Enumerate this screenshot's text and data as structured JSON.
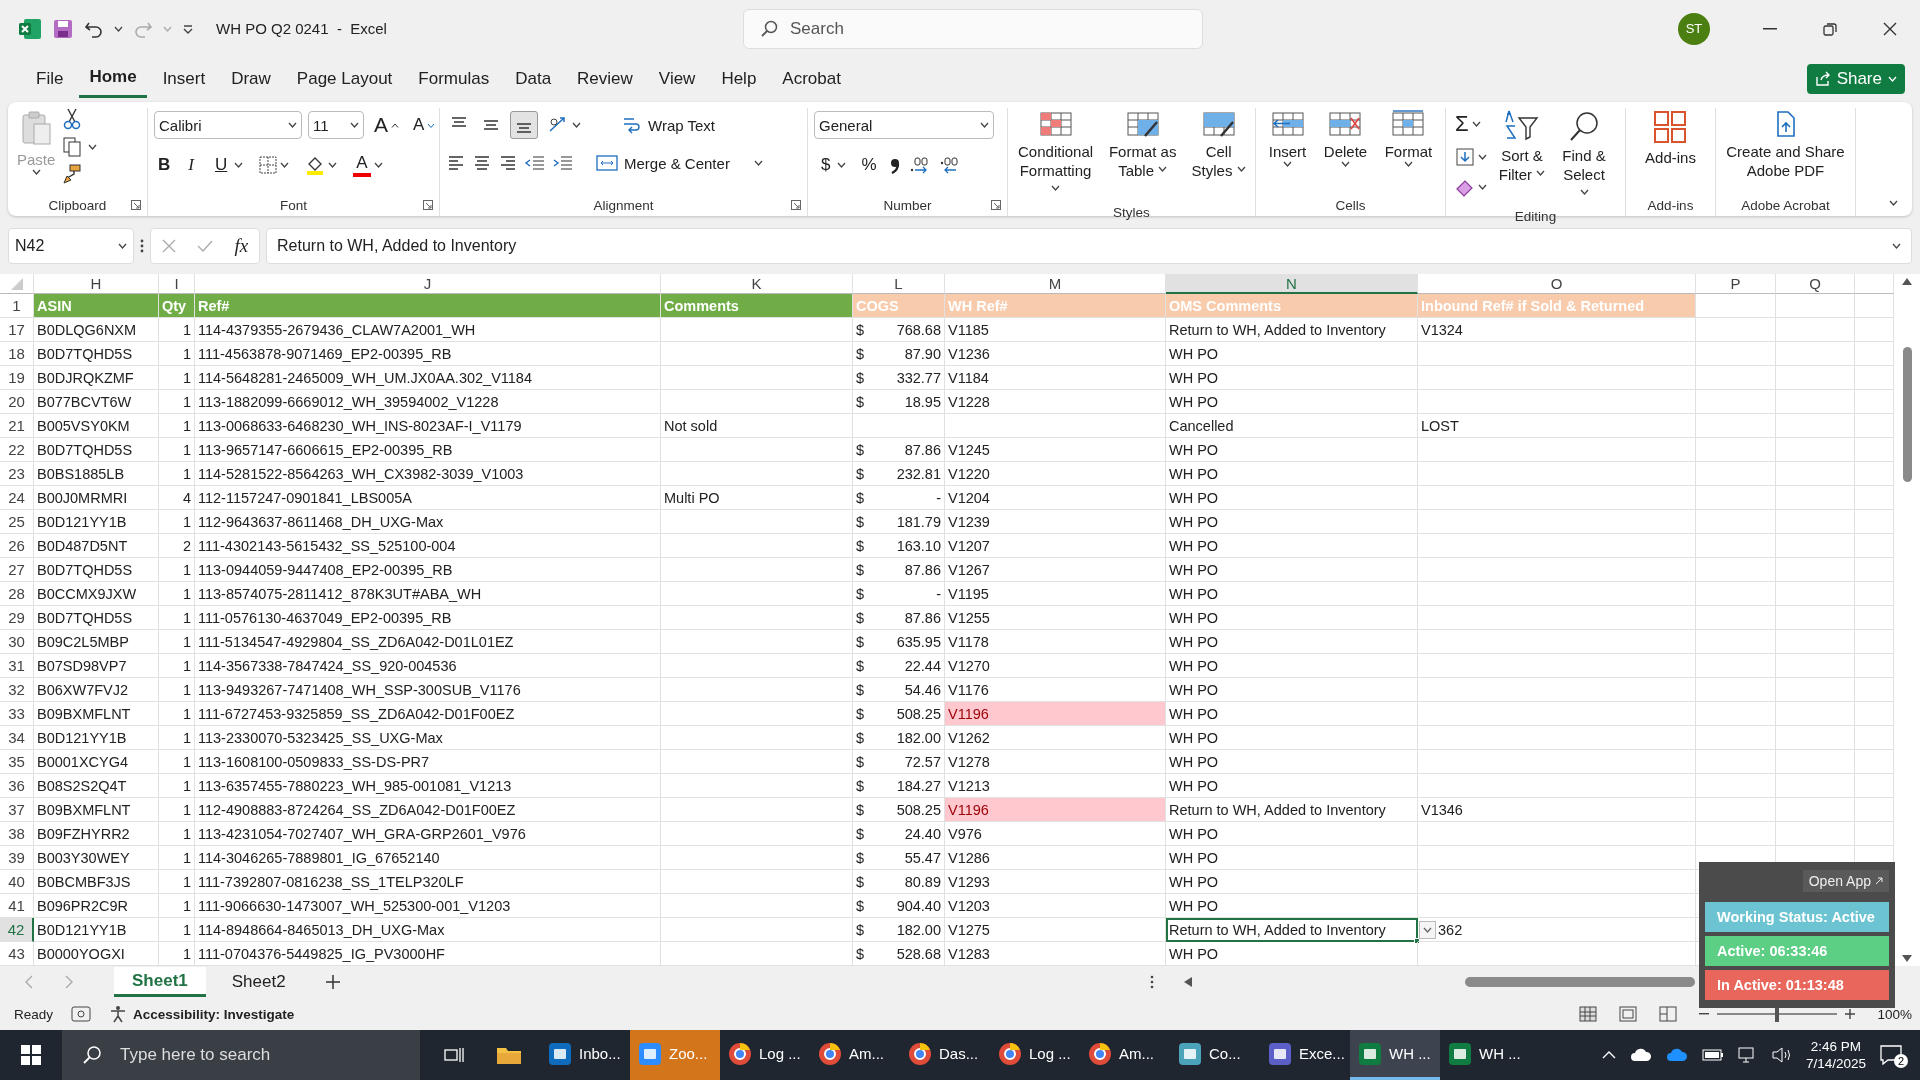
{
  "window": {
    "title": "WH PO Q2 0241  -  Excel",
    "search": {
      "placeholder": "Search"
    },
    "avatar": "ST"
  },
  "menu": [
    {
      "label": "File",
      "selected": false
    },
    {
      "label": "Home",
      "selected": true
    },
    {
      "label": "Insert",
      "selected": false
    },
    {
      "label": "Draw",
      "selected": false
    },
    {
      "label": "Page Layout",
      "selected": false
    },
    {
      "label": "Formulas",
      "selected": false
    },
    {
      "label": "Data",
      "selected": false
    },
    {
      "label": "Review",
      "selected": false
    },
    {
      "label": "View",
      "selected": false
    },
    {
      "label": "Help",
      "selected": false
    },
    {
      "label": "Acrobat",
      "selected": false
    }
  ],
  "share_button": "Share",
  "ribbon": {
    "clipboard": {
      "label": "Clipboard",
      "paste": "Paste",
      "paste_disabled": true
    },
    "font": {
      "label": "Font",
      "face": "Calibri",
      "size": "11",
      "grow": "A",
      "shrink": "A",
      "bold": "B",
      "italic": "I",
      "underline": "U",
      "font_color": "A"
    },
    "alignment": {
      "label": "Alignment",
      "vertical_align": [
        {
          "selected": false
        },
        {
          "selected": false
        },
        {
          "selected": true
        }
      ],
      "wrap": "Wrap Text",
      "merge": "Merge & Center"
    },
    "number": {
      "label": "Number",
      "format": "General",
      "currency": "$",
      "percent": "%"
    },
    "styles": {
      "label": "Styles",
      "buttons": [
        "Conditional Formatting",
        "Format as Table",
        "Cell Styles"
      ]
    },
    "cells": {
      "label": "Cells",
      "buttons": [
        "Insert",
        "Delete",
        "Format"
      ]
    },
    "editing": {
      "label": "Editing",
      "sum": "Σ",
      "buttons": [
        "Sort & Filter",
        "Find & Select"
      ]
    },
    "addins": {
      "label": "Add-ins",
      "buttons": [
        "Add-ins"
      ]
    },
    "acrobat": {
      "label": "Adobe Acrobat",
      "buttons": [
        "Create and Share Adobe PDF"
      ]
    }
  },
  "formula_bar": {
    "name_box": "N42",
    "function_label": "fx",
    "formula": "Return to WH, Added to Inventory"
  },
  "sheet": {
    "columns": [
      {
        "letter": "H",
        "selected": false
      },
      {
        "letter": "I",
        "selected": false
      },
      {
        "letter": "J",
        "selected": false
      },
      {
        "letter": "K",
        "selected": false
      },
      {
        "letter": "L",
        "selected": false
      },
      {
        "letter": "M",
        "selected": false
      },
      {
        "letter": "N",
        "selected": true
      },
      {
        "letter": "O",
        "selected": false
      },
      {
        "letter": "P",
        "selected": false
      },
      {
        "letter": "Q",
        "selected": false
      }
    ],
    "header_row": {
      "row": "1",
      "cells": [
        {
          "text": "ASIN",
          "color": "#70ad47"
        },
        {
          "text": "Qty",
          "color": "#70ad47"
        },
        {
          "text": "Ref#",
          "color": "#70ad47"
        },
        {
          "text": "Comments",
          "color": "#70ad47"
        },
        {
          "text": "COGS",
          "color": "#f8cbad"
        },
        {
          "text": "WH Ref#",
          "color": "#f8cbad"
        },
        {
          "text": "OMS Comments",
          "color": "#f8cbad"
        },
        {
          "text": "Inbound Ref# if Sold & Returned",
          "color": "#f8cbad"
        }
      ]
    },
    "rows": [
      {
        "row": "17",
        "asin": "B0DLQG6NXM",
        "qty": "1",
        "ref": "114-4379355-2679436_CLAW7A2001_WH",
        "cogs": {
          "symbol": "$",
          "amount": "768.68"
        },
        "wh_ref": "V1185",
        "wh_ref_flagged": false,
        "oms_comments": "Return to WH, Added to Inventory",
        "inbound_ref": "V1324",
        "selected": false
      },
      {
        "row": "18",
        "asin": "B0D7TQHD5S",
        "qty": "1",
        "ref": "111-4563878-9071469_EP2-00395_RB",
        "cogs": {
          "symbol": "$",
          "amount": "87.90"
        },
        "wh_ref": "V1236",
        "wh_ref_flagged": false,
        "oms_comments": "WH PO",
        "selected": false
      },
      {
        "row": "19",
        "asin": "B0DJRQKZMF",
        "qty": "1",
        "ref": "114-5648281-2465009_WH_UM.JX0AA.302_V1184",
        "cogs": {
          "symbol": "$",
          "amount": "332.77"
        },
        "wh_ref": "V1184",
        "wh_ref_flagged": false,
        "oms_comments": "WH PO",
        "selected": false
      },
      {
        "row": "20",
        "asin": "B077BCVT6W",
        "qty": "1",
        "ref": "113-1882099-6669012_WH_39594002_V1228",
        "cogs": {
          "symbol": "$",
          "amount": "18.95"
        },
        "wh_ref": "V1228",
        "wh_ref_flagged": false,
        "oms_comments": "WH PO",
        "selected": false
      },
      {
        "row": "21",
        "asin": "B005VSY0KM",
        "qty": "1",
        "ref": "113-0068633-6468230_WH_INS-8023AF-I_V1179",
        "comments": "Not sold",
        "wh_ref_flagged": false,
        "oms_comments": "Cancelled",
        "inbound_ref": "LOST",
        "selected": false
      },
      {
        "row": "22",
        "asin": "B0D7TQHD5S",
        "qty": "1",
        "ref": "113-9657147-6606615_EP2-00395_RB",
        "cogs": {
          "symbol": "$",
          "amount": "87.86"
        },
        "wh_ref": "V1245",
        "wh_ref_flagged": false,
        "oms_comments": "WH PO",
        "selected": false
      },
      {
        "row": "23",
        "asin": "B0BS1885LB",
        "qty": "1",
        "ref": "114-5281522-8564263_WH_CX3982-3039_V1003",
        "cogs": {
          "symbol": "$",
          "amount": "232.81"
        },
        "wh_ref": "V1220",
        "wh_ref_flagged": false,
        "oms_comments": "WH PO",
        "selected": false
      },
      {
        "row": "24",
        "asin": "B00J0MRMRI",
        "qty": "4",
        "ref": "112-1157247-0901841_LBS005A",
        "comments": "Multi PO",
        "cogs": {
          "symbol": "$",
          "amount": "-"
        },
        "wh_ref": "V1204",
        "wh_ref_flagged": false,
        "oms_comments": "WH PO",
        "selected": false
      },
      {
        "row": "25",
        "asin": "B0D121YY1B",
        "qty": "1",
        "ref": "112-9643637-8611468_DH_UXG-Max",
        "cogs": {
          "symbol": "$",
          "amount": "181.79"
        },
        "wh_ref": "V1239",
        "wh_ref_flagged": false,
        "oms_comments": "WH PO",
        "selected": false
      },
      {
        "row": "26",
        "asin": "B0D487D5NT",
        "qty": "2",
        "ref": "111-4302143-5615432_SS_525100-004",
        "cogs": {
          "symbol": "$",
          "amount": "163.10"
        },
        "wh_ref": "V1207",
        "wh_ref_flagged": false,
        "oms_comments": "WH PO",
        "selected": false
      },
      {
        "row": "27",
        "asin": "B0D7TQHD5S",
        "qty": "1",
        "ref": "113-0944059-9447408_EP2-00395_RB",
        "cogs": {
          "symbol": "$",
          "amount": "87.86"
        },
        "wh_ref": "V1267",
        "wh_ref_flagged": false,
        "oms_comments": "WH PO",
        "selected": false
      },
      {
        "row": "28",
        "asin": "B0CCMX9JXW",
        "qty": "1",
        "ref": "113-8574075-2811412_878K3UT#ABA_WH",
        "cogs": {
          "symbol": "$",
          "amount": "-"
        },
        "wh_ref": "V1195",
        "wh_ref_flagged": false,
        "oms_comments": "WH PO",
        "selected": false
      },
      {
        "row": "29",
        "asin": "B0D7TQHD5S",
        "qty": "1",
        "ref": "111-0576130-4637049_EP2-00395_RB",
        "cogs": {
          "symbol": "$",
          "amount": "87.86"
        },
        "wh_ref": "V1255",
        "wh_ref_flagged": false,
        "oms_comments": "WH PO",
        "selected": false
      },
      {
        "row": "30",
        "asin": "B09C2L5MBP",
        "qty": "1",
        "ref": "111-5134547-4929804_SS_ZD6A042-D01L01EZ",
        "cogs": {
          "symbol": "$",
          "amount": "635.95"
        },
        "wh_ref": "V1178",
        "wh_ref_flagged": false,
        "oms_comments": "WH PO",
        "selected": false
      },
      {
        "row": "31",
        "asin": "B07SD98VP7",
        "qty": "1",
        "ref": "114-3567338-7847424_SS_920-004536",
        "cogs": {
          "symbol": "$",
          "amount": "22.44"
        },
        "wh_ref": "V1270",
        "wh_ref_flagged": false,
        "oms_comments": "WH PO",
        "selected": false
      },
      {
        "row": "32",
        "asin": "B06XW7FVJ2",
        "qty": "1",
        "ref": "113-9493267-7471408_WH_SSP-300SUB_V1176",
        "cogs": {
          "symbol": "$",
          "amount": "54.46"
        },
        "wh_ref": "V1176",
        "wh_ref_flagged": false,
        "oms_comments": "WH PO",
        "selected": false
      },
      {
        "row": "33",
        "asin": "B09BXMFLNT",
        "qty": "1",
        "ref": "111-6727453-9325859_SS_ZD6A042-D01F00EZ",
        "cogs": {
          "symbol": "$",
          "amount": "508.25"
        },
        "wh_ref": "V1196",
        "wh_ref_flagged": true,
        "oms_comments": "WH PO",
        "selected": false
      },
      {
        "row": "34",
        "asin": "B0D121YY1B",
        "qty": "1",
        "ref": "113-2330070-5323425_SS_UXG-Max",
        "cogs": {
          "symbol": "$",
          "amount": "182.00"
        },
        "wh_ref": "V1262",
        "wh_ref_flagged": false,
        "oms_comments": "WH PO",
        "selected": false
      },
      {
        "row": "35",
        "asin": "B0001XCYG4",
        "qty": "1",
        "ref": "113-1608100-0509833_SS-DS-PR7",
        "cogs": {
          "symbol": "$",
          "amount": "72.57"
        },
        "wh_ref": "V1278",
        "wh_ref_flagged": false,
        "oms_comments": "WH PO",
        "selected": false
      },
      {
        "row": "36",
        "asin": "B08S2S2Q4T",
        "qty": "1",
        "ref": "113-6357455-7880223_WH_985-001081_V1213",
        "cogs": {
          "symbol": "$",
          "amount": "184.27"
        },
        "wh_ref": "V1213",
        "wh_ref_flagged": false,
        "oms_comments": "WH PO",
        "selected": false
      },
      {
        "row": "37",
        "asin": "B09BXMFLNT",
        "qty": "1",
        "ref": "112-4908883-8724264_SS_ZD6A042-D01F00EZ",
        "cogs": {
          "symbol": "$",
          "amount": "508.25"
        },
        "wh_ref": "V1196",
        "wh_ref_flagged": true,
        "oms_comments": "Return to WH, Added to Inventory",
        "inbound_ref": "V1346",
        "selected": false
      },
      {
        "row": "38",
        "asin": "B09FZHYRR2",
        "qty": "1",
        "ref": "113-4231054-7027407_WH_GRA-GRP2601_V976",
        "cogs": {
          "symbol": "$",
          "amount": "24.40"
        },
        "wh_ref": "V976",
        "wh_ref_flagged": false,
        "oms_comments": "WH PO",
        "selected": false
      },
      {
        "row": "39",
        "asin": "B003Y30WEY",
        "qty": "1",
        "ref": "114-3046265-7889801_IG_67652140",
        "cogs": {
          "symbol": "$",
          "amount": "55.47"
        },
        "wh_ref": "V1286",
        "wh_ref_flagged": false,
        "oms_comments": "WH PO",
        "selected": false
      },
      {
        "row": "40",
        "asin": "B0BCMBF3JS",
        "qty": "1",
        "ref": "111-7392807-0816238_SS_1TELP320LF",
        "cogs": {
          "symbol": "$",
          "amount": "80.89"
        },
        "wh_ref": "V1293",
        "wh_ref_flagged": false,
        "oms_comments": "WH PO",
        "selected": false
      },
      {
        "row": "41",
        "asin": "B096PR2C9R",
        "qty": "1",
        "ref": "111-9066630-1473007_WH_525300-001_V1203",
        "cogs": {
          "symbol": "$",
          "amount": "904.40"
        },
        "wh_ref": "V1203",
        "wh_ref_flagged": false,
        "oms_comments": "WH PO",
        "selected": false
      },
      {
        "row": "42",
        "asin": "B0D121YY1B",
        "qty": "1",
        "ref": "114-8948664-8465013_DH_UXG-Max",
        "cogs": {
          "symbol": "$",
          "amount": "182.00"
        },
        "wh_ref": "V1275",
        "wh_ref_flagged": false,
        "oms_comments": "Return to WH, Added to Inventory",
        "inbound_ref": "362",
        "selected": true
      },
      {
        "row": "43",
        "asin": "B0000YOGXI",
        "qty": "1",
        "ref": "111-0704376-5449825_IG_PV3000HF",
        "cogs": {
          "symbol": "$",
          "amount": "528.68"
        },
        "wh_ref": "V1283",
        "wh_ref_flagged": false,
        "oms_comments": "WH PO",
        "selected": false
      }
    ]
  },
  "sheet_tabs": [
    {
      "label": "Sheet1",
      "selected": true
    },
    {
      "label": "Sheet2",
      "selected": false
    }
  ],
  "status_bar": {
    "ready": "Ready",
    "accessibility": "Accessibility: Investigate",
    "zoom": "100%",
    "zoom_level": {
      "level": 0.5
    }
  },
  "status_widget": {
    "open_button": "Open App",
    "items": [
      {
        "text": "Working Status: Active",
        "color": "#6cc4d3"
      },
      {
        "text": "Active: 06:33:46",
        "color": "#5ccf85"
      },
      {
        "text": "In Active: 01:13:48",
        "color": "#e8665b"
      }
    ]
  },
  "taskbar": {
    "search": {
      "placeholder": "Type here to search"
    },
    "apps": [
      {
        "label": "Inbo...",
        "active": false,
        "attention": false
      },
      {
        "label": "Zoo...",
        "active": false,
        "attention": true
      },
      {
        "label": "Log ...",
        "active": false,
        "attention": false
      },
      {
        "label": "Am...",
        "active": false,
        "attention": false
      },
      {
        "label": "Das...",
        "active": false,
        "attention": false
      },
      {
        "label": "Log ...",
        "active": false,
        "attention": false
      },
      {
        "label": "Am...",
        "active": false,
        "attention": false
      },
      {
        "label": "Co...",
        "active": false,
        "attention": false
      },
      {
        "label": "Exce...",
        "active": false,
        "attention": false
      },
      {
        "label": "WH ...",
        "active": true,
        "attention": false
      },
      {
        "label": "WH ...",
        "active": false,
        "attention": false
      }
    ],
    "time": "2:46 PM",
    "date": "7/14/2025",
    "notifications": "2"
  }
}
